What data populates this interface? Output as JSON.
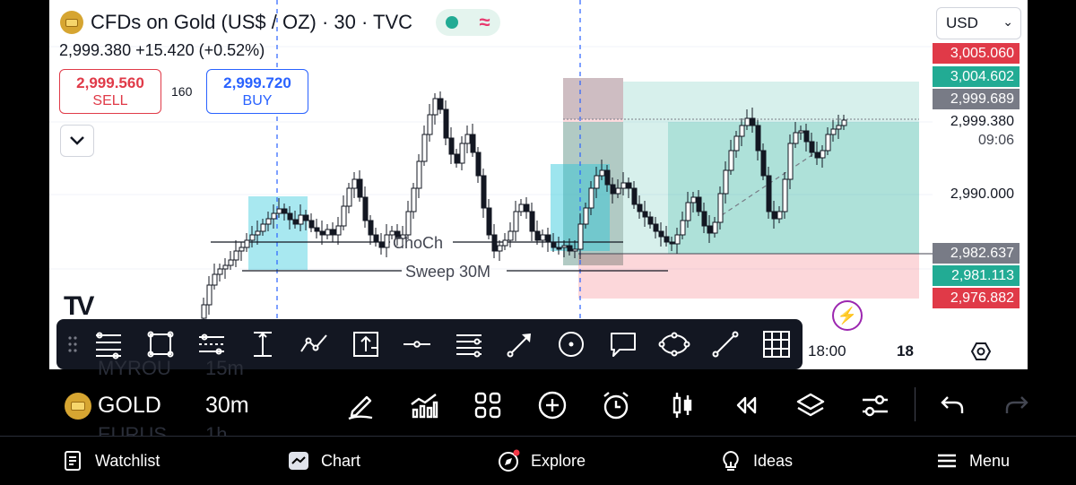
{
  "header": {
    "title": "CFDs on Gold (US$ / OZ) · 30 · TVC",
    "status_icons": [
      "market-open-dot-icon",
      "delayed-data-wave-icon"
    ],
    "price_line": "2,999.380  +15.420 (+0.52%)",
    "currency": "USD"
  },
  "trade_buttons": {
    "sell_price": "2,999.560",
    "sell_label": "SELL",
    "spread": "160",
    "buy_price": "2,999.720",
    "buy_label": "BUY"
  },
  "price_tags": [
    {
      "value": "3,005.060",
      "color": "#e03a48"
    },
    {
      "value": "3,004.602",
      "color": "#22ab94"
    },
    {
      "value": "2,999.689",
      "color": "#787b86"
    },
    {
      "value": "2,982.637",
      "color": "#787b86"
    },
    {
      "value": "2,981.113",
      "color": "#22ab94"
    },
    {
      "value": "2,976.882",
      "color": "#e03a48"
    }
  ],
  "axis": {
    "last_price": "2,999.380",
    "countdown": "09:06",
    "level_2990": "2,990.000",
    "time_1800": "18:00",
    "time_18": "18"
  },
  "annotations": {
    "choch": "ChoCh",
    "sweep": "Sweep 30M"
  },
  "colors": {
    "bull_candle": "#ffffff",
    "bear_candle": "#131722",
    "profit_zone": "#22ab94",
    "loss_zone": "#f23645",
    "fvg_box": "#26c6da",
    "session_line": "#2962ff"
  },
  "drawing_tools": [
    "fib-retracement-icon",
    "rectangle-icon",
    "parallel-channel-icon",
    "measure-icon",
    "path-icon",
    "long-position-icon",
    "horizontal-line-icon",
    "fib-levels-icon",
    "arrow-icon",
    "circle-icon",
    "callout-icon",
    "ellipse-icon",
    "trend-line-icon",
    "grid-icon"
  ],
  "symbol_bar": {
    "name": "GOLD",
    "interval": "30m",
    "ghost_above_name": "MYROU",
    "ghost_above_interval": "15m",
    "ghost_below_name": "EURUS",
    "ghost_below_interval": "1h"
  },
  "bottom_nav": [
    {
      "label": "Watchlist"
    },
    {
      "label": "Chart"
    },
    {
      "label": "Explore"
    },
    {
      "label": "Ideas"
    },
    {
      "label": "Menu"
    }
  ]
}
